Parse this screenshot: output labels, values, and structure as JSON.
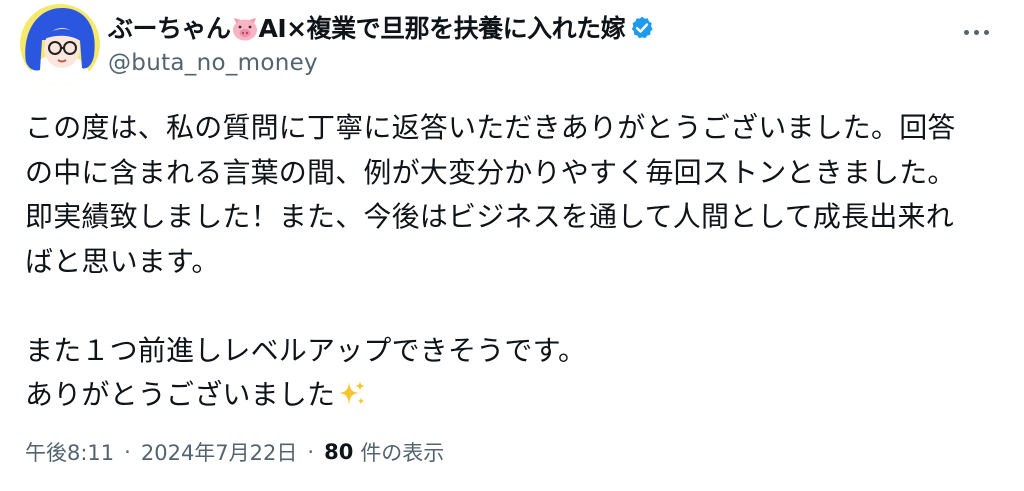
{
  "tweet": {
    "display_name_before": "ぶーちゃん",
    "display_name_after": "AI×複業で旦那を扶養に入れた嫁",
    "handle": "@buta_no_money",
    "lines": [
      "この度は、私の質問に丁寧に返答いただきありがとうございました。回答",
      "の中に含まれる言葉の間、例が大変分かりやすく毎回ストンときました。",
      "即実績致しました！また、今後はビジネスを通して人間として成長出来れ",
      "ばと思います。",
      "",
      "また１つ前進しレベルアップできそうです。",
      "ありがとうございました"
    ],
    "time": "午後8:11",
    "separator": "·",
    "date": "2024年7月22日",
    "views_count": "80",
    "views_label": "件の表示"
  },
  "icons": {
    "avatar": "avatar",
    "pig": "pig-face-emoji-icon",
    "verified": "verified-badge-icon",
    "more": "more-options-icon",
    "sparkles": "sparkles-emoji-icon"
  },
  "colors": {
    "text": "#0f1419",
    "secondary": "#536471",
    "verified": "#1d9bf0"
  }
}
